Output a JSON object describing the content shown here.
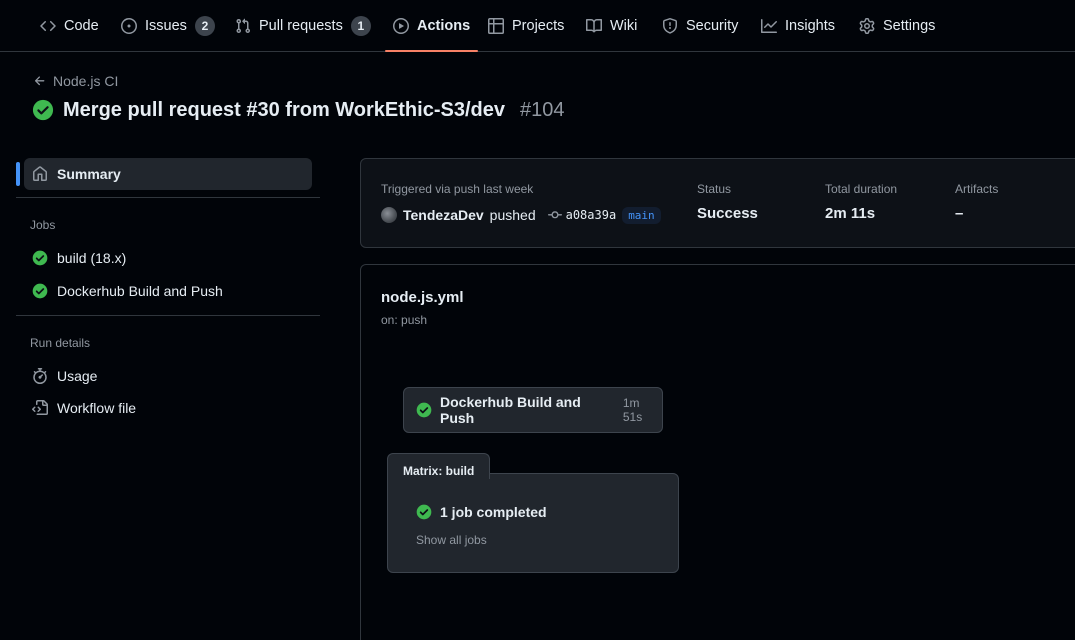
{
  "colors": {
    "accent_underline": "#f78166",
    "success": "#3fb950",
    "link_blue": "#4493f8",
    "bg": "#010409",
    "muted": "#9198a1"
  },
  "nav": {
    "tabs": [
      {
        "label": "Code",
        "icon": "code-icon"
      },
      {
        "label": "Issues",
        "icon": "issue-opened-icon",
        "count": "2"
      },
      {
        "label": "Pull requests",
        "icon": "git-pull-request-icon",
        "count": "1"
      },
      {
        "label": "Actions",
        "icon": "play-icon",
        "active": true
      },
      {
        "label": "Projects",
        "icon": "table-icon"
      },
      {
        "label": "Wiki",
        "icon": "book-icon"
      },
      {
        "label": "Security",
        "icon": "shield-icon"
      },
      {
        "label": "Insights",
        "icon": "graph-icon"
      },
      {
        "label": "Settings",
        "icon": "gear-icon"
      }
    ]
  },
  "header": {
    "back_label": "Node.js CI",
    "title": "Merge pull request #30 from WorkEthic-S3/dev",
    "run_number": "#104"
  },
  "sidebar": {
    "summary_label": "Summary",
    "jobs_title": "Jobs",
    "jobs": [
      {
        "label": "build (18.x)",
        "status": "success"
      },
      {
        "label": "Dockerhub Build and Push",
        "status": "success"
      }
    ],
    "run_details_title": "Run details",
    "details": [
      {
        "label": "Usage",
        "icon": "stopwatch-icon"
      },
      {
        "label": "Workflow file",
        "icon": "file-code-icon"
      }
    ]
  },
  "summary": {
    "trigger_label": "Triggered via push last week",
    "actor": "TendezaDev",
    "action": "pushed",
    "commit": "a08a39a",
    "branch": "main",
    "status_label": "Status",
    "status_value": "Success",
    "duration_label": "Total duration",
    "duration_value": "2m 11s",
    "artifacts_label": "Artifacts",
    "artifacts_value": "–"
  },
  "workflow": {
    "file_name": "node.js.yml",
    "trigger": "on: push",
    "job": {
      "name": "Dockerhub Build and Push",
      "duration": "1m 51s"
    },
    "matrix": {
      "title": "Matrix: build",
      "completed_label": "1 job completed",
      "show_all_label": "Show all jobs"
    }
  }
}
